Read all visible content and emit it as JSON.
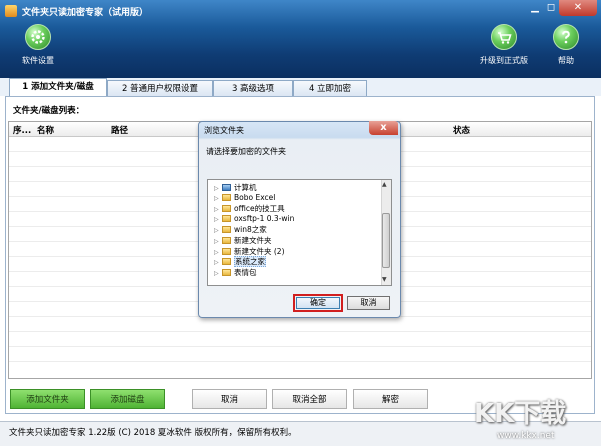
{
  "window": {
    "title": "文件夹只读加密专家（试用版）",
    "min_glyph": "▁",
    "restore_glyph": "◻",
    "close_glyph": "✕"
  },
  "toolbar": {
    "settings_label": "软件设置",
    "upgrade_label": "升级到正式版",
    "help_label": "帮助"
  },
  "tabs": [
    {
      "label": "1 添加文件夹/磁盘",
      "active": true
    },
    {
      "label": "2 普通用户权限设置",
      "active": false
    },
    {
      "label": "3 高级选项",
      "active": false
    },
    {
      "label": "4 立即加密",
      "active": false
    }
  ],
  "list": {
    "caption": "文件夹/磁盘列表：",
    "columns": {
      "seq": "序...",
      "name": "名称",
      "path": "路径",
      "status": "状态"
    }
  },
  "buttons": {
    "add_folder": "添加文件夹",
    "add_disk": "添加磁盘",
    "cancel": "取消",
    "cancel_all": "取消全部",
    "decrypt": "解密"
  },
  "status_bar": "文件夹只读加密专家 1.22版 (C) 2018 夏冰软件 版权所有，保留所有权利。",
  "watermark": {
    "text": "KK下载",
    "url": "www.kkx.net"
  },
  "dialog": {
    "title": "浏览文件夹",
    "prompt": "请选择要加密的文件夹",
    "tree": [
      {
        "label": "计算机",
        "icon": "computer-icon",
        "selected": false
      },
      {
        "label": "Bobo Excel",
        "icon": "folder-icon",
        "selected": false
      },
      {
        "label": "office的技工具",
        "icon": "folder-icon",
        "selected": false
      },
      {
        "label": "oxsftp-1 0.3-win",
        "icon": "folder-icon",
        "selected": false
      },
      {
        "label": "win8之家",
        "icon": "folder-icon",
        "selected": false
      },
      {
        "label": "新建文件夹",
        "icon": "folder-icon",
        "selected": false
      },
      {
        "label": "新建文件夹 (2)",
        "icon": "folder-icon",
        "selected": false
      },
      {
        "label": "系统之家",
        "icon": "folder-icon",
        "selected": true
      },
      {
        "label": "表情包",
        "icon": "folder-icon",
        "selected": false
      }
    ],
    "ok_label": "确定",
    "cancel_label": "取消"
  }
}
